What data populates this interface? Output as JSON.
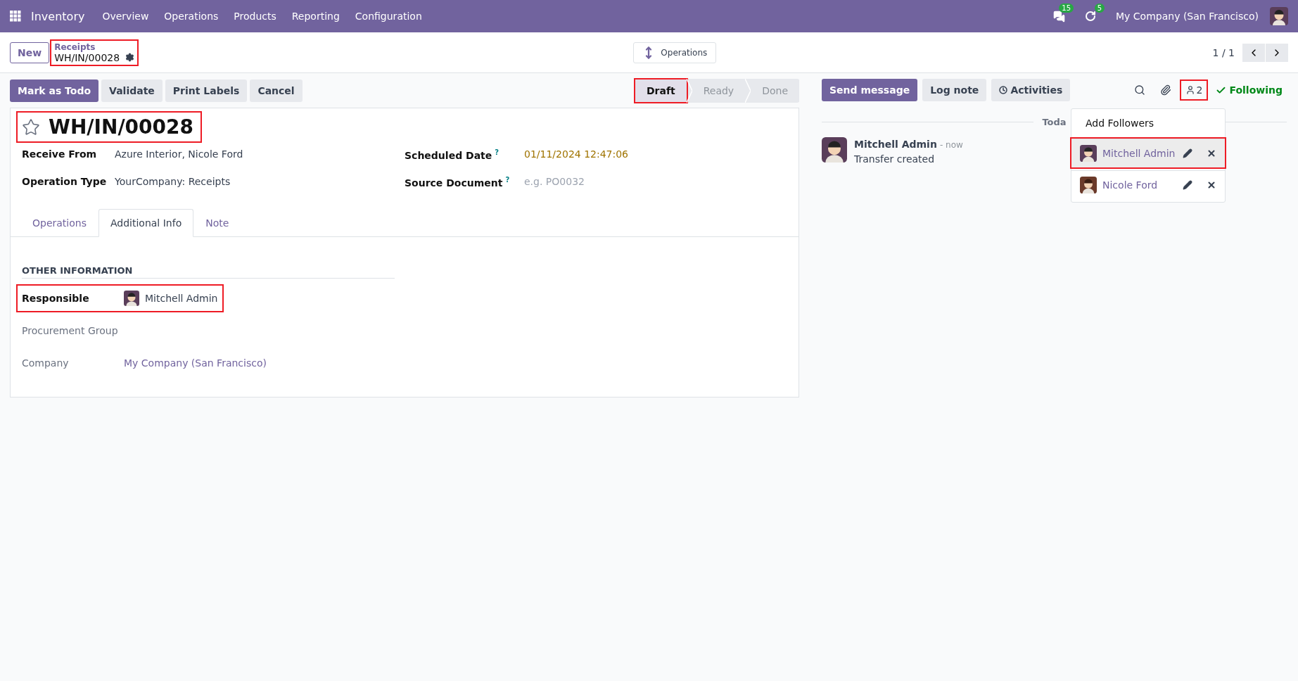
{
  "navbar": {
    "app": "Inventory",
    "menu": [
      "Overview",
      "Operations",
      "Products",
      "Reporting",
      "Configuration"
    ],
    "messages_count": "15",
    "activities_count": "5",
    "company": "My Company (San Francisco)"
  },
  "control_panel": {
    "new_button": "New",
    "breadcrumb": {
      "parent": "Receipts",
      "current": "WH/IN/00028",
      "highlighted": true
    },
    "center_button": "Operations",
    "pager": "1 / 1"
  },
  "actions": [
    {
      "label": "Mark as Todo",
      "primary": true
    },
    {
      "label": "Validate",
      "primary": false
    },
    {
      "label": "Print Labels",
      "primary": false
    },
    {
      "label": "Cancel",
      "primary": false
    }
  ],
  "stages": [
    {
      "label": "Draft",
      "selected": true,
      "highlighted": true
    },
    {
      "label": "Ready",
      "selected": false,
      "highlighted": false
    },
    {
      "label": "Done",
      "selected": false,
      "highlighted": false
    }
  ],
  "form": {
    "title": "WH/IN/00028",
    "starred": false,
    "title_highlighted": true,
    "fields_left": [
      {
        "label": "Receive From",
        "value": "Azure Interior, Nicole Ford"
      },
      {
        "label": "Operation Type",
        "value": "YourCompany: Receipts"
      }
    ],
    "fields_right": [
      {
        "label": "Scheduled Date",
        "help": "?",
        "value": "01/11/2024 12:47:06"
      },
      {
        "label": "Source Document",
        "help": "?",
        "placeholder": "e.g. PO0032"
      }
    ],
    "tabs": [
      {
        "label": "Operations",
        "selected": false
      },
      {
        "label": "Additional Info",
        "selected": true
      },
      {
        "label": "Note",
        "selected": false
      }
    ],
    "section": "OTHER INFORMATION",
    "other_fields": [
      {
        "label": "Responsible",
        "kind": "user",
        "value": "Mitchell Admin",
        "required": true,
        "highlighted": true
      },
      {
        "label": "Procurement Group",
        "kind": "empty",
        "required": false,
        "highlighted": false
      },
      {
        "label": "Company",
        "kind": "link",
        "value": "My Company (San Francisco)",
        "required": false,
        "highlighted": false
      }
    ]
  },
  "chatter": {
    "buttons": [
      {
        "label": "Send message",
        "primary": true
      },
      {
        "label": "Log note",
        "primary": false
      },
      {
        "label": "Activities",
        "primary": false
      }
    ],
    "followers_count": "2",
    "followers_highlighted": true,
    "following": "Following",
    "divider": "Toda",
    "messages": [
      {
        "author": "Mitchell Admin",
        "time": "- now",
        "body": "Transfer created"
      }
    ],
    "followers_menu": {
      "add": "Add Followers",
      "followers": [
        {
          "name": "Mitchell Admin",
          "highlighted": true
        },
        {
          "name": "Nicole Ford",
          "highlighted": false
        }
      ]
    }
  }
}
